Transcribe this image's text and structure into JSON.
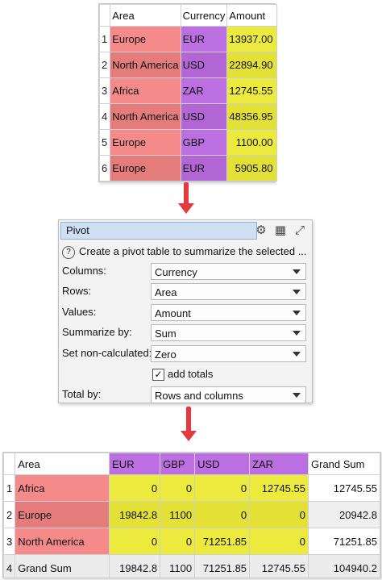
{
  "source_table": {
    "headers": [
      "Area",
      "Currency",
      "Amount"
    ],
    "rows": [
      {
        "idx": "1",
        "area": "Europe",
        "currency": "EUR",
        "amount": "13937.00"
      },
      {
        "idx": "2",
        "area": "North America",
        "currency": "USD",
        "amount": "22894.90"
      },
      {
        "idx": "3",
        "area": "Africa",
        "currency": "ZAR",
        "amount": "12745.55"
      },
      {
        "idx": "4",
        "area": "North America",
        "currency": "USD",
        "amount": "48356.95"
      },
      {
        "idx": "5",
        "area": "Europe",
        "currency": "GBP",
        "amount": "1100.00"
      },
      {
        "idx": "6",
        "area": "Europe",
        "currency": "EUR",
        "amount": "5905.80"
      }
    ]
  },
  "pivot": {
    "title": "Pivot",
    "icons": [
      "gear-icon",
      "table-icon",
      "expand-icon"
    ],
    "description": "Create a pivot table to summarize the selected ...",
    "fields": [
      {
        "label": "Columns:",
        "value": "Currency"
      },
      {
        "label": "Rows:",
        "value": "Area"
      },
      {
        "label": "Values:",
        "value": "Amount"
      },
      {
        "label": "Summarize by:",
        "value": "Sum"
      },
      {
        "label": "Set non-calculated:",
        "value": "Zero"
      }
    ],
    "add_totals": {
      "label": "add totals",
      "checked": true
    },
    "total_by": {
      "label": "Total by:",
      "value": "Rows and columns"
    }
  },
  "result_table": {
    "headers": [
      "Area",
      "EUR",
      "GBP",
      "USD",
      "ZAR",
      "Grand Sum"
    ],
    "rows": [
      {
        "idx": "1",
        "area": "Africa",
        "EUR": "0",
        "GBP": "0",
        "USD": "0",
        "ZAR": "12745.55",
        "grand": "12745.55"
      },
      {
        "idx": "2",
        "area": "Europe",
        "EUR": "19842.8",
        "GBP": "1100",
        "USD": "0",
        "ZAR": "0",
        "grand": "20942.8"
      },
      {
        "idx": "3",
        "area": "North America",
        "EUR": "0",
        "GBP": "0",
        "USD": "71251.85",
        "ZAR": "0",
        "grand": "71251.85"
      }
    ],
    "total_row": {
      "idx": "4",
      "label": "Grand Sum",
      "EUR": "19842.8",
      "GBP": "1100",
      "USD": "71251.85",
      "ZAR": "12745.55",
      "grand": "104940.2"
    }
  },
  "colors": {
    "area": "#f48a8a",
    "currency": "#bc6fe0",
    "amount": "#ecea3d",
    "arrow": "#e4393f"
  }
}
